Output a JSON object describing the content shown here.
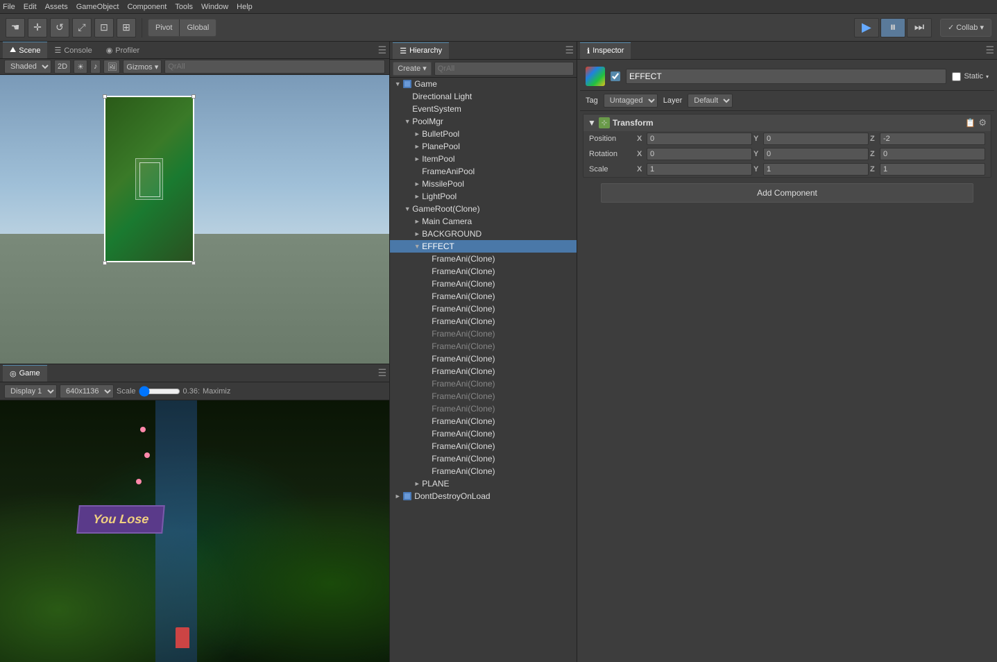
{
  "menubar": {
    "items": [
      "File",
      "Edit",
      "Assets",
      "GameObject",
      "Component",
      "Tools",
      "Window",
      "Help"
    ]
  },
  "toolbar": {
    "tools": [
      "☚",
      "✛",
      "↺",
      "⤢",
      "⊡",
      "⊞"
    ],
    "pivot": "Pivot",
    "global": "Global",
    "play": "▶",
    "pause": "⏸",
    "step": "⏭",
    "collab": "✓ Collab ▾"
  },
  "scene_tab": {
    "tabs": [
      "Scene",
      "Console",
      "Profiler"
    ],
    "active": "Scene",
    "shading": "Shaded",
    "mode_2d": "2D",
    "gizmos": "Gizmos ▾",
    "search_placeholder": "QrAll"
  },
  "game_tab": {
    "label": "Game",
    "display": "Display 1",
    "resolution": "640x1136",
    "scale": "Scale",
    "scale_value": "0.36:",
    "maximize": "Maximiz",
    "you_lose": "You Lose"
  },
  "hierarchy": {
    "title": "Hierarchy",
    "create_label": "Create ▾",
    "search_placeholder": "QrAll",
    "items": [
      {
        "id": "game",
        "label": "Game",
        "level": 0,
        "arrow": "▼",
        "icon": "🎮",
        "expanded": true
      },
      {
        "id": "directional-light",
        "label": "Directional Light",
        "level": 1,
        "arrow": "",
        "icon": ""
      },
      {
        "id": "eventsystem",
        "label": "EventSystem",
        "level": 1,
        "arrow": "",
        "icon": ""
      },
      {
        "id": "poolmgr",
        "label": "PoolMgr",
        "level": 1,
        "arrow": "▼",
        "icon": "",
        "expanded": true
      },
      {
        "id": "bulletpool",
        "label": "BulletPool",
        "level": 2,
        "arrow": "►",
        "icon": ""
      },
      {
        "id": "planepool",
        "label": "PlanePool",
        "level": 2,
        "arrow": "►",
        "icon": ""
      },
      {
        "id": "itempool",
        "label": "ItemPool",
        "level": 2,
        "arrow": "►",
        "icon": ""
      },
      {
        "id": "frameanipool",
        "label": "FrameAniPool",
        "level": 2,
        "arrow": "",
        "icon": ""
      },
      {
        "id": "missilepool",
        "label": "MissilePool",
        "level": 2,
        "arrow": "►",
        "icon": ""
      },
      {
        "id": "lightpool",
        "label": "LightPool",
        "level": 2,
        "arrow": "►",
        "icon": ""
      },
      {
        "id": "gameroot",
        "label": "GameRoot(Clone)",
        "level": 1,
        "arrow": "▼",
        "icon": "",
        "expanded": true
      },
      {
        "id": "main-camera",
        "label": "Main Camera",
        "level": 2,
        "arrow": "►",
        "icon": ""
      },
      {
        "id": "background",
        "label": "BACKGROUND",
        "level": 2,
        "arrow": "►",
        "icon": ""
      },
      {
        "id": "effect",
        "label": "EFFECT",
        "level": 2,
        "arrow": "▼",
        "icon": "",
        "selected": true
      },
      {
        "id": "frameani1",
        "label": "FrameAni(Clone)",
        "level": 3,
        "arrow": "",
        "icon": ""
      },
      {
        "id": "frameani2",
        "label": "FrameAni(Clone)",
        "level": 3,
        "arrow": "",
        "icon": ""
      },
      {
        "id": "frameani3",
        "label": "FrameAni(Clone)",
        "level": 3,
        "arrow": "",
        "icon": ""
      },
      {
        "id": "frameani4",
        "label": "FrameAni(Clone)",
        "level": 3,
        "arrow": "",
        "icon": ""
      },
      {
        "id": "frameani5",
        "label": "FrameAni(Clone)",
        "level": 3,
        "arrow": "",
        "icon": ""
      },
      {
        "id": "frameani6",
        "label": "FrameAni(Clone)",
        "level": 3,
        "arrow": "",
        "icon": ""
      },
      {
        "id": "frameani7",
        "label": "FrameAni(Clone)",
        "level": 3,
        "arrow": "",
        "icon": "",
        "disabled": true
      },
      {
        "id": "frameani8",
        "label": "FrameAni(Clone)",
        "level": 3,
        "arrow": "",
        "icon": "",
        "disabled": true
      },
      {
        "id": "frameani9",
        "label": "FrameAni(Clone)",
        "level": 3,
        "arrow": "",
        "icon": ""
      },
      {
        "id": "frameani10",
        "label": "FrameAni(Clone)",
        "level": 3,
        "arrow": "",
        "icon": ""
      },
      {
        "id": "frameani11",
        "label": "FrameAni(Clone)",
        "level": 3,
        "arrow": "",
        "icon": "",
        "disabled": true
      },
      {
        "id": "frameani12",
        "label": "FrameAni(Clone)",
        "level": 3,
        "arrow": "",
        "icon": "",
        "disabled": true
      },
      {
        "id": "frameani13",
        "label": "FrameAni(Clone)",
        "level": 3,
        "arrow": "",
        "icon": "",
        "disabled": true
      },
      {
        "id": "frameani14",
        "label": "FrameAni(Clone)",
        "level": 3,
        "arrow": "",
        "icon": ""
      },
      {
        "id": "frameani15",
        "label": "FrameAni(Clone)",
        "level": 3,
        "arrow": "",
        "icon": ""
      },
      {
        "id": "frameani16",
        "label": "FrameAni(Clone)",
        "level": 3,
        "arrow": "",
        "icon": ""
      },
      {
        "id": "frameani17",
        "label": "FrameAni(Clone)",
        "level": 3,
        "arrow": "",
        "icon": ""
      },
      {
        "id": "frameani18",
        "label": "FrameAni(Clone)",
        "level": 3,
        "arrow": "",
        "icon": ""
      },
      {
        "id": "plane",
        "label": "PLANE",
        "level": 2,
        "arrow": "►",
        "icon": ""
      },
      {
        "id": "dontdestroy",
        "label": "DontDestroyOnLoad",
        "level": 0,
        "arrow": "►",
        "icon": "🎮"
      }
    ]
  },
  "inspector": {
    "title": "Inspector",
    "obj_name": "EFFECT",
    "obj_checked": true,
    "static_label": "Static",
    "tag_label": "Tag",
    "tag_value": "Untagged",
    "layer_label": "Layer",
    "layer_value": "Default",
    "transform": {
      "title": "Transform",
      "position": {
        "label": "Position",
        "x": "0",
        "y": "0",
        "z": "-2"
      },
      "rotation": {
        "label": "Rotation",
        "x": "0",
        "y": "0",
        "z": "0"
      },
      "scale": {
        "label": "Scale",
        "x": "1",
        "y": "1",
        "z": "1"
      }
    },
    "add_component": "Add Component"
  }
}
